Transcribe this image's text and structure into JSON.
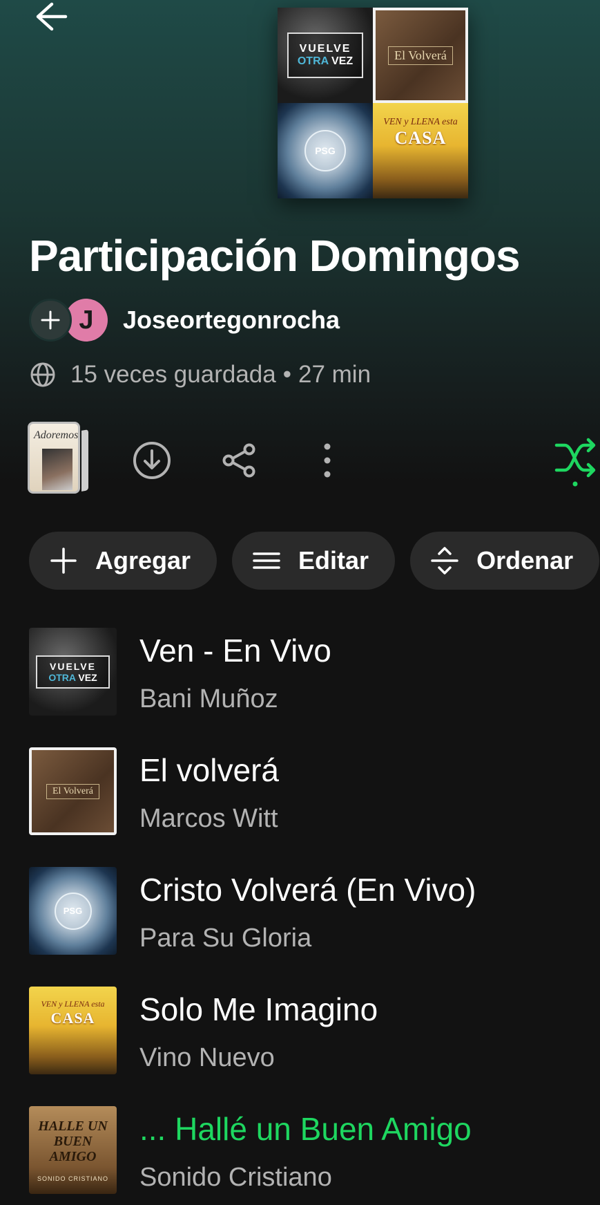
{
  "colors": {
    "accent": "#1ed760",
    "background": "#121212",
    "header_gradient_top": "#1f4a47",
    "chip_bg": "#2a2a2a",
    "secondary_text": "#b3b3b3",
    "avatar_bg": "#e07ca8"
  },
  "header": {
    "back_icon": "arrow-left-icon",
    "cover_tiles": [
      {
        "name": "vuelve-otra-vez-cover",
        "line1": "VUELVE",
        "line2a": "OTRA",
        "line2b": "VEZ"
      },
      {
        "name": "el-volvera-cover",
        "label": "El Volverá"
      },
      {
        "name": "psg-cover",
        "label": "PSG"
      },
      {
        "name": "ven-y-llena-esta-casa-cover",
        "line1": "VEN y LLENA esta",
        "line2": "CASA"
      }
    ]
  },
  "playlist": {
    "title": "Participación Domingos",
    "owner_initial": "J",
    "owner": "Joseortegonrocha",
    "saves": "15 veces guardada",
    "separator": "•",
    "duration": "27 min"
  },
  "actions": {
    "mini_cover_label": "Adoremos",
    "download_icon": "download-icon",
    "share_icon": "share-icon",
    "more_icon": "more-vertical-icon",
    "shuffle_icon": "shuffle-icon"
  },
  "chips": [
    {
      "label": "Agregar",
      "icon": "plus-icon"
    },
    {
      "label": "Editar",
      "icon": "lines-icon"
    },
    {
      "label": "Ordenar",
      "icon": "sort-icon"
    }
  ],
  "tracks": [
    {
      "title": "Ven - En Vivo",
      "artist": "Bani Muñoz",
      "playing": false
    },
    {
      "title": "El volverá",
      "artist": "Marcos Witt",
      "playing": false
    },
    {
      "title": "Cristo Volverá (En Vivo)",
      "artist": "Para Su Gloria",
      "playing": false
    },
    {
      "title": "Solo Me Imagino",
      "artist": "Vino Nuevo",
      "playing": false
    },
    {
      "title": "... Hallé un Buen Amigo",
      "artist": "Sonido Cristiano",
      "playing": true,
      "art_line1": "HALLE UN",
      "art_line2": "BUEN AMIGO",
      "art_sub": "SONIDO CRISTIANO"
    }
  ]
}
